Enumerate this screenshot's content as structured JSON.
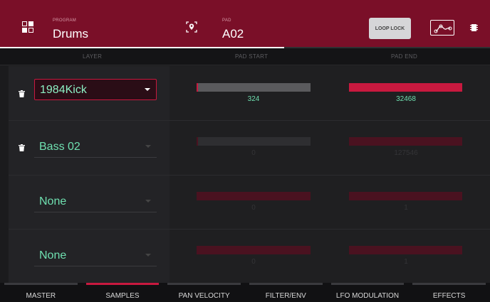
{
  "header": {
    "program_label": "PROGRAM",
    "program_value": "Drums",
    "pad_label": "PAD",
    "pad_value": "A02",
    "loop_lock_label": "LOOP LOCK",
    "accent_color": "#7a0f28",
    "progress_fraction": 0.58
  },
  "columns": {
    "layer": "LAYER",
    "pad_start": "PAD START",
    "pad_end": "PAD END"
  },
  "layers": [
    {
      "sample": "1984Kick",
      "start": "324",
      "end": "32468",
      "active": true,
      "start_fraction": 0.01,
      "end_fraction": 1.0
    },
    {
      "sample": "Bass 02",
      "start": "0",
      "end": "127546",
      "active": false,
      "start_fraction": 0.0,
      "end_fraction": 1.0
    },
    {
      "sample": "None",
      "start": "0",
      "end": "1",
      "active": false,
      "start_fraction": 0.0,
      "end_fraction": 1.0
    },
    {
      "sample": "None",
      "start": "0",
      "end": "1",
      "active": false,
      "start_fraction": 0.0,
      "end_fraction": 1.0
    }
  ],
  "tabs": [
    {
      "label": "MASTER",
      "active": false
    },
    {
      "label": "SAMPLES",
      "active": true
    },
    {
      "label": "PAN VELOCITY",
      "active": false
    },
    {
      "label": "FILTER/ENV",
      "active": false
    },
    {
      "label": "LFO MODULATION",
      "active": false
    },
    {
      "label": "EFFECTS",
      "active": false
    }
  ]
}
